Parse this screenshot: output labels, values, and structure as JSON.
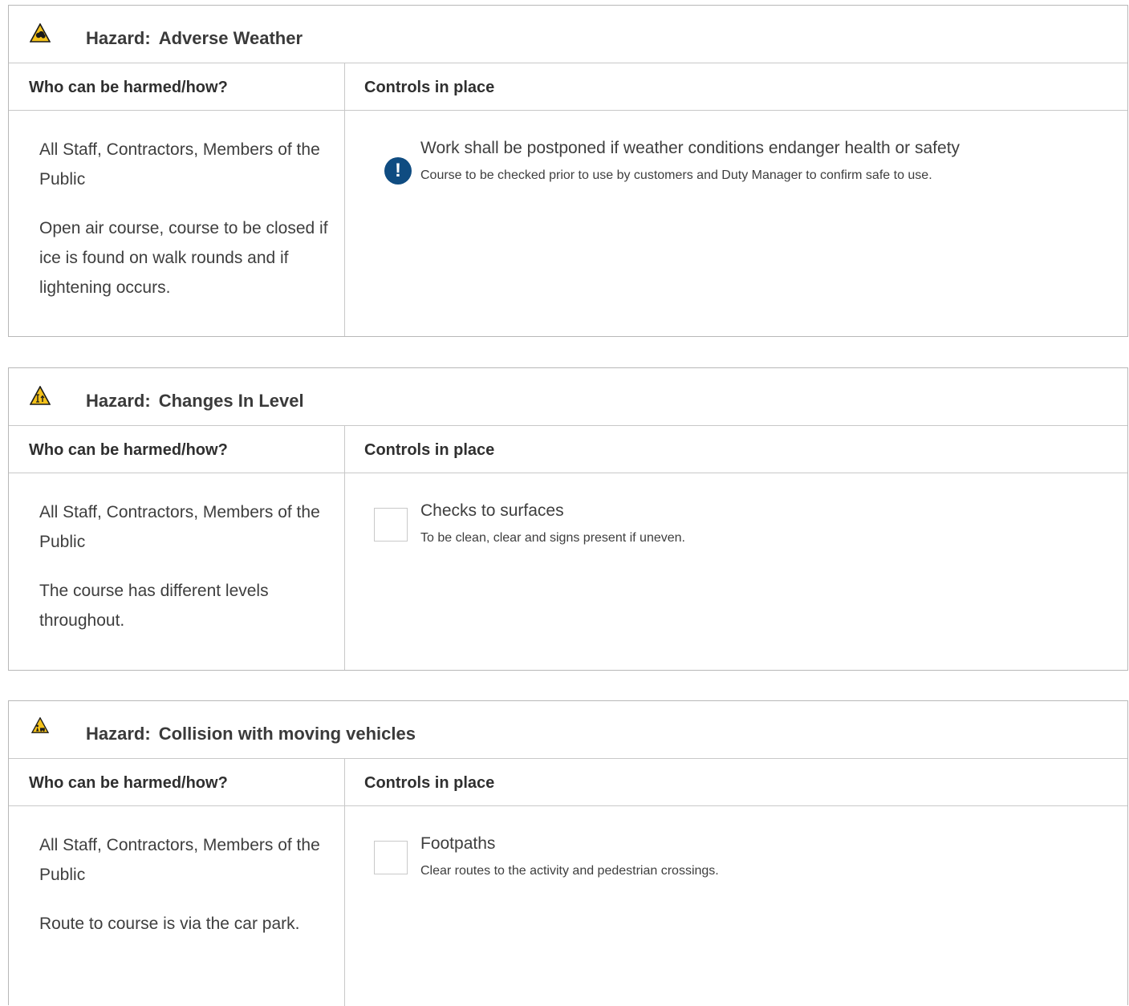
{
  "column_headers": {
    "who": "Who can be harmed/how?",
    "controls": "Controls in place"
  },
  "hazards": [
    {
      "prefix": "Hazard:",
      "name": "Adverse Weather",
      "icon": "weather-warning-icon",
      "who": "All Staff, Contractors, Members of the Public",
      "description": "Open air course, course to be closed if ice is found on walk rounds and if lightening occurs.",
      "control": {
        "marker": "alert",
        "marker_glyph": "!",
        "title": "Work shall be postponed if weather conditions endanger health or safety",
        "detail": "Course to be checked prior to use by customers and Duty Manager to confirm safe to use."
      }
    },
    {
      "prefix": "Hazard:",
      "name": "Changes In Level",
      "icon": "level-change-warning-icon",
      "who": "All Staff, Contractors, Members of the Public",
      "description": "The course has different levels throughout.",
      "control": {
        "marker": "checkbox",
        "title": "Checks to surfaces",
        "detail": "To be clean, clear and signs present if uneven."
      }
    },
    {
      "prefix": "Hazard:",
      "name": "Collision with moving vehicles",
      "icon": "vehicle-collision-warning-icon",
      "who": "All Staff, Contractors, Members of the Public",
      "description": "Route to course is via the car park.",
      "control": {
        "marker": "checkbox",
        "title": "Footpaths",
        "detail": "Clear routes to the activity and pedestrian crossings."
      }
    }
  ],
  "colors": {
    "warning_yellow": "#f4c21a",
    "alert_blue": "#0f4c81",
    "border": "#b8b8b8"
  }
}
